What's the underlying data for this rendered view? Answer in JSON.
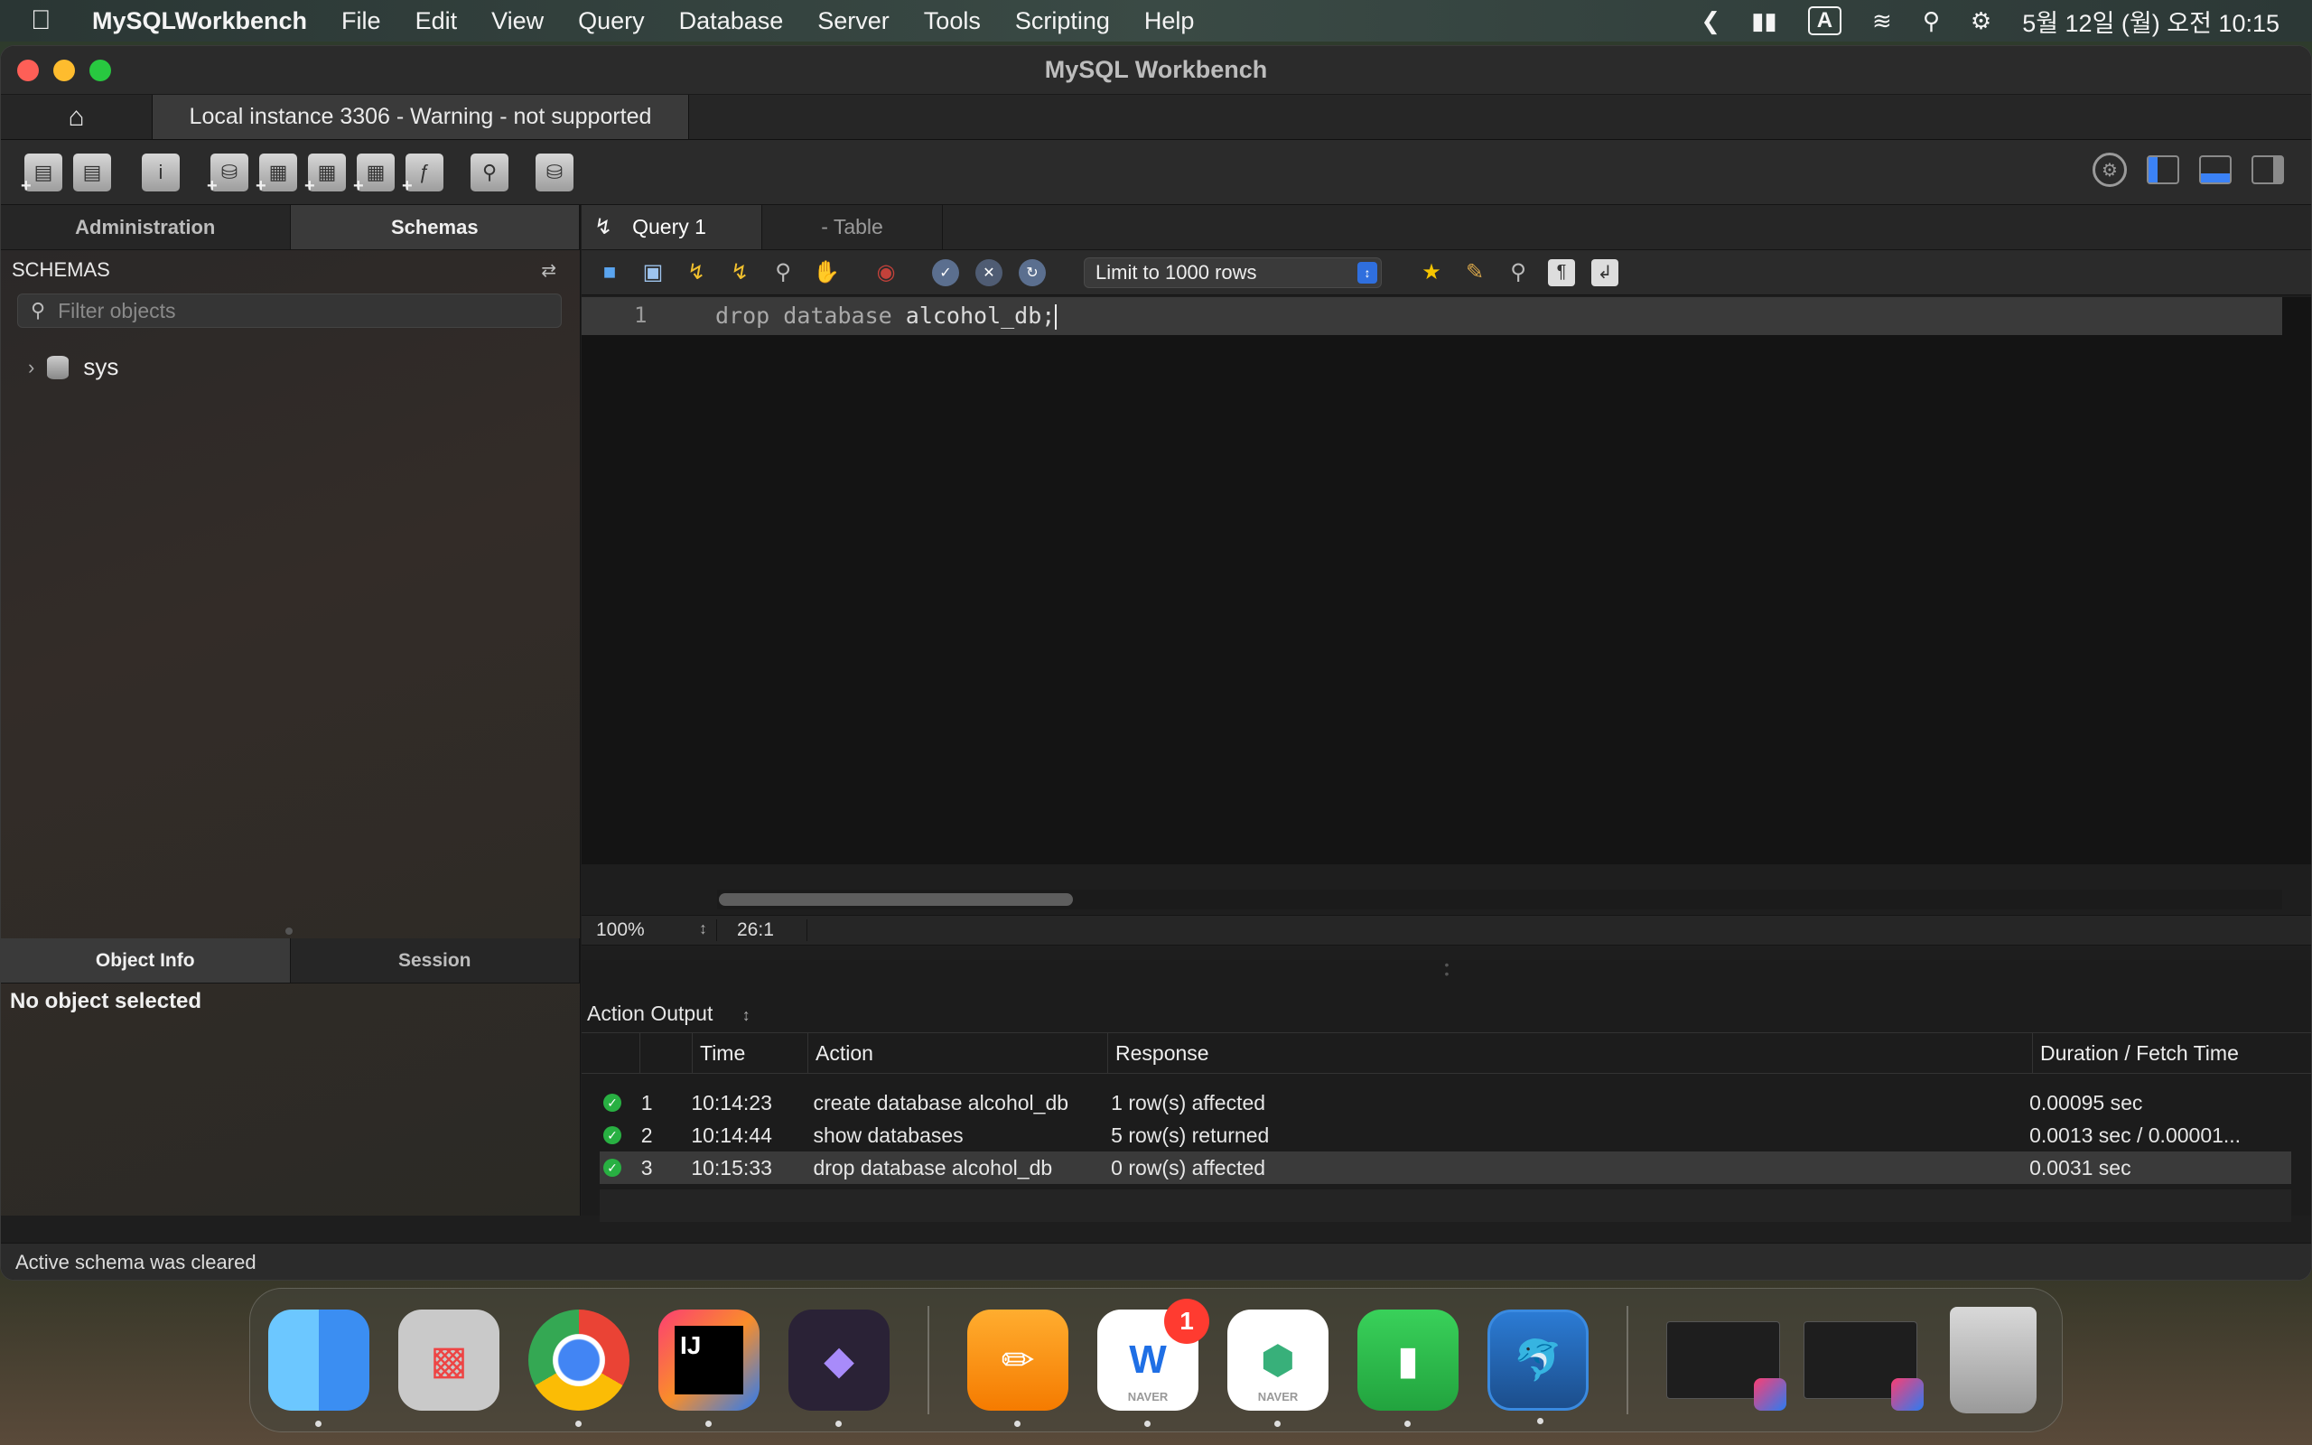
{
  "menubar": {
    "app_name": "MySQLWorkbench",
    "items": [
      "File",
      "Edit",
      "View",
      "Query",
      "Database",
      "Server",
      "Tools",
      "Scripting",
      "Help"
    ],
    "input_indicator": "A",
    "datetime": "5월 12일 (월) 오전 10:15"
  },
  "window": {
    "title": "MySQL Workbench",
    "connection_tab": "Local instance 3306 - Warning - not supported"
  },
  "sidebar": {
    "tabs": [
      "Administration",
      "Schemas"
    ],
    "active_tab": "Schemas",
    "header": "SCHEMAS",
    "filter_placeholder": "Filter objects",
    "schemas": [
      "sys"
    ],
    "bottom_tabs": [
      "Object Info",
      "Session"
    ],
    "object_info_text": "No object selected"
  },
  "editor": {
    "tabs": [
      {
        "label": "Query 1",
        "active": true
      },
      {
        "label": "- Table",
        "active": false
      }
    ],
    "limit_select": "Limit to 1000 rows",
    "lines": [
      {
        "number": "1",
        "text": "drop database alcohol_db;"
      }
    ],
    "tokens": {
      "kw1": "drop",
      "kw2": "database",
      "ident": "alcohol_db;"
    },
    "zoom": "100%",
    "cursor_pos": "26:1"
  },
  "output": {
    "selector": "Action Output",
    "columns": [
      "Time",
      "Action",
      "Response",
      "Duration / Fetch Time"
    ],
    "rows": [
      {
        "num": "1",
        "time": "10:14:23",
        "action": "create database alcohol_db",
        "response": "1 row(s) affected",
        "duration": "0.00095 sec",
        "status": "ok"
      },
      {
        "num": "2",
        "time": "10:14:44",
        "action": "show databases",
        "response": "5 row(s) returned",
        "duration": "0.0013 sec / 0.00001...",
        "status": "ok"
      },
      {
        "num": "3",
        "time": "10:15:33",
        "action": "drop database alcohol_db",
        "response": "0 row(s) affected",
        "duration": "0.0031 sec",
        "status": "ok"
      }
    ]
  },
  "statusbar": {
    "text": "Active schema was cleared"
  },
  "dock": {
    "apps": [
      "Finder",
      "Launchpad",
      "Chrome",
      "IntelliJ IDEA",
      "Obsidian",
      "Pages",
      "Naver Whale",
      "Naver Box",
      "Numbers",
      "MySQL Workbench"
    ],
    "whale_badge": "1",
    "whale_label": "NAVER",
    "box_label": "NAVER",
    "ij_label": "IJ"
  },
  "colors": {
    "accent": "#3b82f6",
    "success": "#28b042",
    "stop": "#c2413a"
  }
}
